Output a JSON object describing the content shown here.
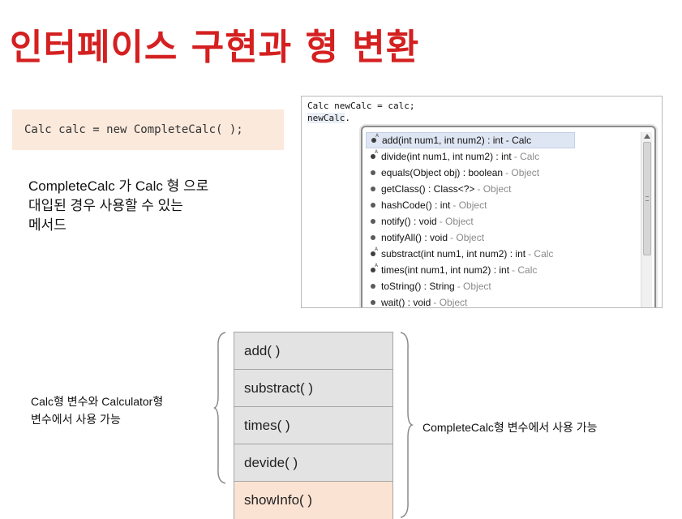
{
  "slide": {
    "title": "인터페이스 구현과 형 변환",
    "code_snippet": "Calc calc = new CompleteCalc( );",
    "description_lines": [
      "CompleteCalc 가 Calc 형 으로",
      "대입된 경우 사용할 수 있는",
      "메서드"
    ]
  },
  "ide": {
    "line1": "Calc newCalc = calc;",
    "line2_prefix": "newCalc",
    "line2_suffix": ".",
    "items": [
      {
        "sig": "add(int num1, int num2) : int - Calc",
        "owner": "",
        "icon": "abstract-method-icon"
      },
      {
        "sig": "divide(int num1, int num2) : int",
        "owner": "- Calc",
        "icon": "abstract-method-icon"
      },
      {
        "sig": "equals(Object obj) : boolean",
        "owner": "- Object",
        "icon": "method-icon"
      },
      {
        "sig": "getClass() : Class<?>",
        "owner": "- Object",
        "icon": "method-icon"
      },
      {
        "sig": "hashCode() : int",
        "owner": "- Object",
        "icon": "method-icon"
      },
      {
        "sig": "notify() : void",
        "owner": "- Object",
        "icon": "method-icon"
      },
      {
        "sig": "notifyAll() : void",
        "owner": "- Object",
        "icon": "method-icon"
      },
      {
        "sig": "substract(int num1, int num2) : int",
        "owner": "- Calc",
        "icon": "abstract-method-icon"
      },
      {
        "sig": "times(int num1, int num2) : int",
        "owner": "- Calc",
        "icon": "abstract-method-icon"
      },
      {
        "sig": "toString() : String",
        "owner": "- Object",
        "icon": "method-icon"
      },
      {
        "sig": "wait() : void",
        "owner": "- Object",
        "icon": "method-icon"
      }
    ]
  },
  "diagram": {
    "left_label_lines": [
      "Calc형 변수와 Calculator형",
      "변수에서 사용 가능"
    ],
    "methods": [
      "add( )",
      "substract( )",
      "times( )",
      "devide( )",
      "showInfo( )"
    ],
    "right_label": "CompleteCalc형 변수에서 사용 가능",
    "colors": {
      "common_method_bg": "#e3e3e3",
      "extra_method_bg": "#fbe3d3",
      "title": "#d42020"
    }
  }
}
